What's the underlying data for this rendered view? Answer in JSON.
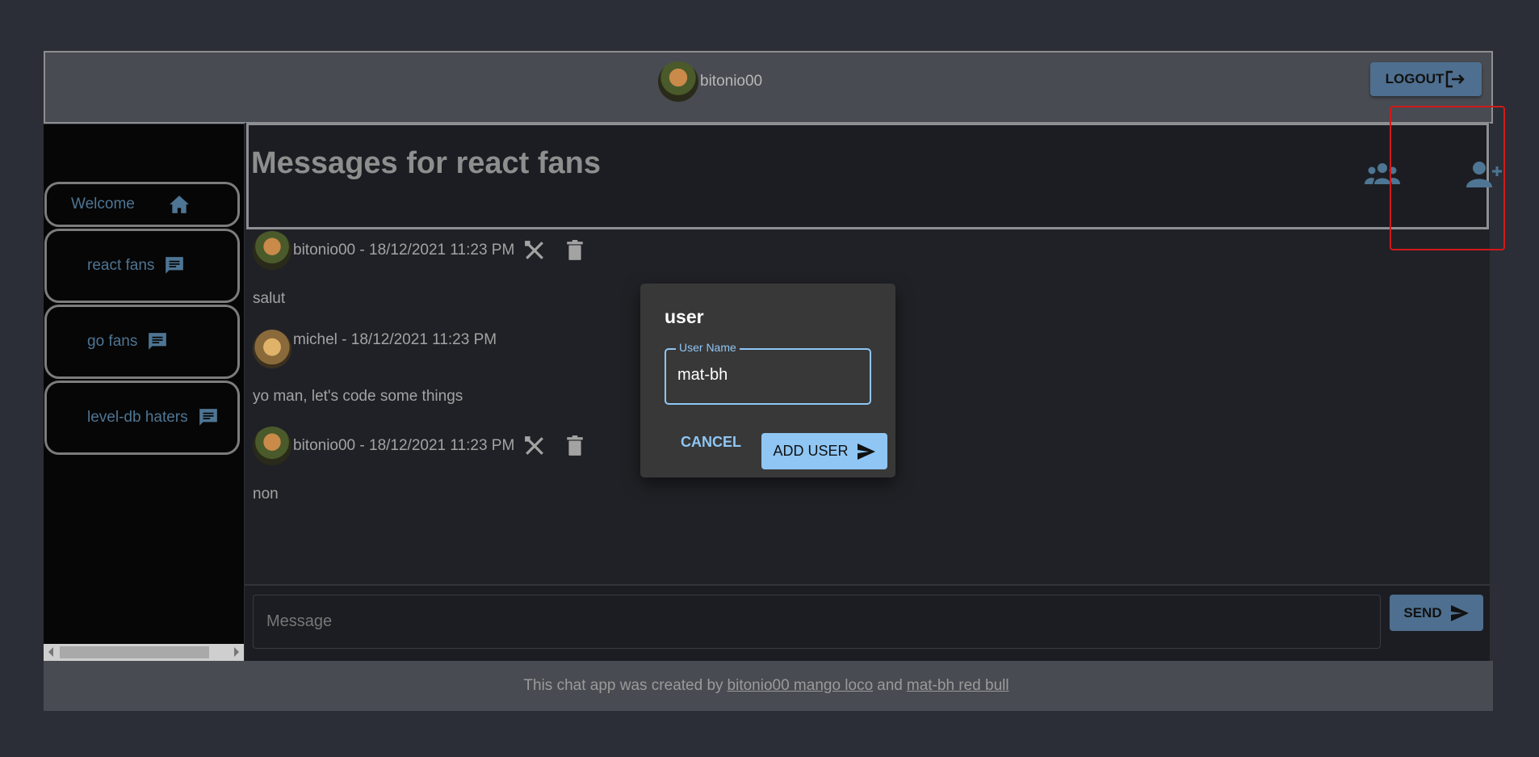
{
  "header": {
    "username": "bitonio00",
    "logout_label": "LOGOUT"
  },
  "sidebar": {
    "items": [
      {
        "label": "Welcome",
        "icon": "home-icon"
      },
      {
        "label": "react fans",
        "icon": "chat-icon"
      },
      {
        "label": "go fans",
        "icon": "chat-icon"
      },
      {
        "label": "level-db haters",
        "icon": "chat-icon"
      }
    ]
  },
  "channel": {
    "title": "Messages for react fans",
    "actions": [
      "group-icon",
      "add-user-icon"
    ]
  },
  "messages": [
    {
      "author": "bitonio00",
      "meta": "bitonio00 - 18/12/2021 11:23 PM",
      "text": "salut",
      "editable": true
    },
    {
      "author": "michel",
      "meta": "michel - 18/12/2021 11:23 PM",
      "text": "yo man, let's code some things",
      "editable": false
    },
    {
      "author": "bitonio00",
      "meta": "bitonio00 - 18/12/2021 11:23 PM",
      "text": "non",
      "editable": true
    }
  ],
  "compose": {
    "placeholder": "Message",
    "send_label": "SEND"
  },
  "footer": {
    "text_before": "This chat app was created by",
    "link1": "bitonio00 mango loco",
    "text_middle": "and",
    "link2": "mat-bh red bull"
  },
  "dialog": {
    "title": "user",
    "field_label": "User Name",
    "field_value": "mat-bh",
    "cancel_label": "CANCEL",
    "add_label": "ADD USER"
  },
  "colors": {
    "accent": "#4e6f8f",
    "dialog_accent": "#8fc6f4",
    "highlight": "#d01a1a"
  }
}
